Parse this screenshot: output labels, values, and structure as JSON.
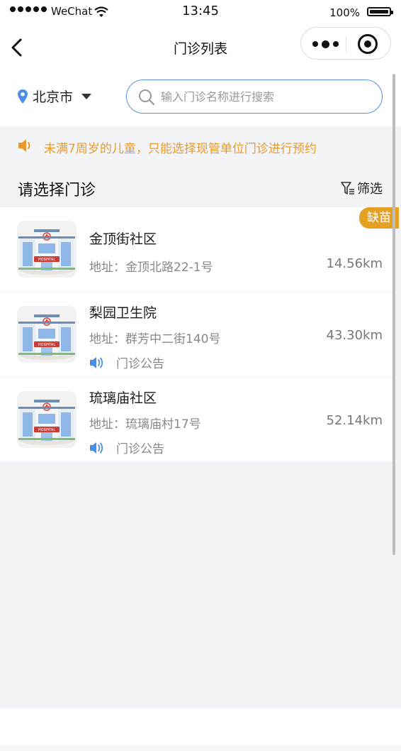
{
  "status_bar": {
    "carrier": "WeChat",
    "time": "13:45",
    "battery": "100%"
  },
  "nav": {
    "title": "门诊列表"
  },
  "search": {
    "city": "北京市",
    "placeholder": "输入门诊名称进行搜索"
  },
  "notice": {
    "text": "未满7周岁的儿童，只能选择现管单位门诊进行预约"
  },
  "section": {
    "title": "请选择门诊",
    "filter_label": "筛选"
  },
  "badge": {
    "label": "缺苗"
  },
  "clinics": [
    {
      "name": "金顶街社区",
      "address": "地址：金顶北路22-1号",
      "distance": "14.56km"
    },
    {
      "name": "梨园卫生院",
      "address": "地址：群芳中二街140号",
      "distance": "43.30km",
      "notice_label": "门诊公告"
    },
    {
      "name": "琉璃庙社区",
      "address": "地址：琉璃庙村17号",
      "distance": "52.14km",
      "notice_label": "门诊公告"
    }
  ],
  "thumbnail_sign": "HOSPITAL",
  "colors": {
    "accent_blue": "#5b8fd8",
    "notice_orange": "#e89b2c",
    "badge_orange": "#e6a023",
    "background_grey": "#f3f4f8"
  },
  "icons": [
    "location-pin-icon",
    "chevron-down-icon",
    "search-icon",
    "speaker-icon",
    "filter-icon",
    "back-arrow-icon",
    "more-icon",
    "close-icon",
    "hospital-icon"
  ]
}
